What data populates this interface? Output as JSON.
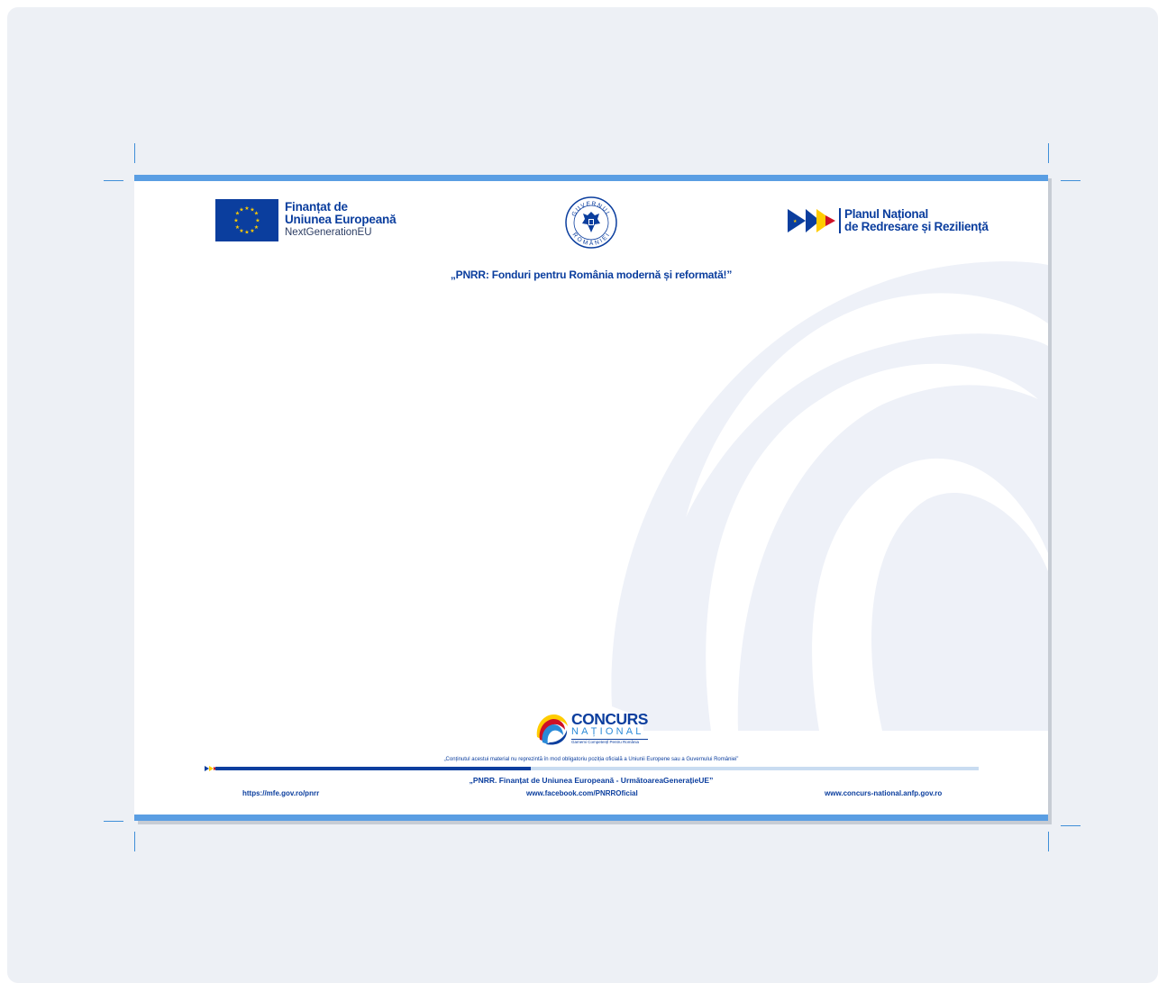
{
  "eu_logo": {
    "line1": "Finanțat de",
    "line2": "Uniunea Europeană",
    "line3": "NextGenerationEU"
  },
  "gov_seal": {
    "icon": "romanian-government-seal-icon",
    "top_text": "GUVERNUL",
    "bottom_text": "ROMÂNIEI"
  },
  "pnrr_logo": {
    "line1": "Planul Național",
    "line2": "de Redresare și Reziliență"
  },
  "slogan": "„PNRR: Fonduri pentru România modernă și reformată!”",
  "concurs_logo": {
    "line1": "CONCURS",
    "line2": "NAȚIONAL",
    "line3": "Gamemi Competențl Pentru România"
  },
  "footer": {
    "disclaimer": "„Conținutul acestui material nu reprezintă în mod obligatoriu poziția oficială a Uniunii Europene sau a Guvernului României”",
    "slogan": "„PNRR. Finanțat de Uniunea Europeană - UrmătoareaGenerațieUE”",
    "links": [
      "https://mfe.gov.ro/pnrr",
      "www.facebook.com/PNRROficial",
      "www.concurs-national.anfp.gov.ro"
    ]
  },
  "colors": {
    "brand_blue": "#0b3e9e",
    "accent_band": "#5a9ee3",
    "background": "#edf0f5",
    "watermark": "#eef1f7",
    "eu_star": "#ffcc00",
    "ro_red": "#ce1126"
  }
}
